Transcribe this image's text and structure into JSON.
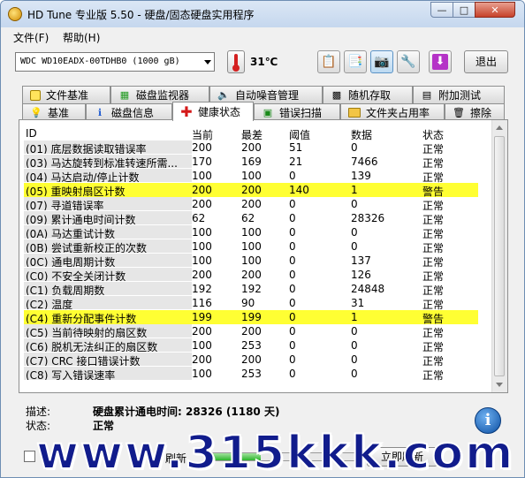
{
  "window": {
    "title": "HD Tune 专业版 5.50 - 硬盘/固态硬盘实用程序"
  },
  "menu": {
    "file": "文件(F)",
    "help": "帮助(H)"
  },
  "toolbar": {
    "drive": "WDC WD10EADX-00TDHB0 (1000 gB)",
    "temperature": "31℃",
    "exit_label": "退出"
  },
  "tabs_row1": [
    "文件基准",
    "磁盘监视器",
    "自动噪音管理",
    "随机存取",
    "附加测试"
  ],
  "tabs_row2": [
    "基准",
    "磁盘信息",
    "健康状态",
    "错误扫描",
    "文件夹占用率",
    "擦除"
  ],
  "active_tab": "健康状态",
  "columns": [
    "ID",
    "当前",
    "最差",
    "阈值",
    "数据",
    "状态"
  ],
  "rows": [
    {
      "id": "(01) 底层数据读取错误率",
      "current": "200",
      "worst": "200",
      "threshold": "51",
      "data": "0",
      "status": "正常",
      "warning": false
    },
    {
      "id": "(03) 马达旋转到标准转速所需...",
      "current": "170",
      "worst": "169",
      "threshold": "21",
      "data": "7466",
      "status": "正常",
      "warning": false
    },
    {
      "id": "(04) 马达启动/停止计数",
      "current": "100",
      "worst": "100",
      "threshold": "0",
      "data": "139",
      "status": "正常",
      "warning": false
    },
    {
      "id": "(05) 重映射扇区计数",
      "current": "200",
      "worst": "200",
      "threshold": "140",
      "data": "1",
      "status": "警告",
      "warning": true
    },
    {
      "id": "(07) 寻道错误率",
      "current": "200",
      "worst": "200",
      "threshold": "0",
      "data": "0",
      "status": "正常",
      "warning": false
    },
    {
      "id": "(09) 累计通电时间计数",
      "current": "62",
      "worst": "62",
      "threshold": "0",
      "data": "28326",
      "status": "正常",
      "warning": false
    },
    {
      "id": "(0A) 马达重试计数",
      "current": "100",
      "worst": "100",
      "threshold": "0",
      "data": "0",
      "status": "正常",
      "warning": false
    },
    {
      "id": "(0B) 尝试重新校正的次数",
      "current": "100",
      "worst": "100",
      "threshold": "0",
      "data": "0",
      "status": "正常",
      "warning": false
    },
    {
      "id": "(0C) 通电周期计数",
      "current": "100",
      "worst": "100",
      "threshold": "0",
      "data": "137",
      "status": "正常",
      "warning": false
    },
    {
      "id": "(C0) 不安全关闭计数",
      "current": "200",
      "worst": "200",
      "threshold": "0",
      "data": "126",
      "status": "正常",
      "warning": false
    },
    {
      "id": "(C1) 负载周期数",
      "current": "192",
      "worst": "192",
      "threshold": "0",
      "data": "24848",
      "status": "正常",
      "warning": false
    },
    {
      "id": "(C2) 温度",
      "current": "116",
      "worst": "90",
      "threshold": "0",
      "data": "31",
      "status": "正常",
      "warning": false
    },
    {
      "id": "(C4) 重新分配事件计数",
      "current": "199",
      "worst": "199",
      "threshold": "0",
      "data": "1",
      "status": "警告",
      "warning": true
    },
    {
      "id": "(C5) 当前待映射的扇区数",
      "current": "200",
      "worst": "200",
      "threshold": "0",
      "data": "0",
      "status": "正常",
      "warning": false
    },
    {
      "id": "(C6) 脱机无法纠正的扇区数",
      "current": "100",
      "worst": "253",
      "threshold": "0",
      "data": "0",
      "status": "正常",
      "warning": false
    },
    {
      "id": "(C7) CRC 接口错误计数",
      "current": "200",
      "worst": "200",
      "threshold": "0",
      "data": "0",
      "status": "正常",
      "warning": false
    },
    {
      "id": "(C8) 写入错误速率",
      "current": "100",
      "worst": "253",
      "threshold": "0",
      "data": "0",
      "status": "正常",
      "warning": false
    }
  ],
  "info": {
    "desc_label": "描述:",
    "desc_value": "硬盘累计通电时间: 28326 (1180 天)",
    "status_label": "状态:",
    "status_value": "正常"
  },
  "bottom": {
    "refresh_label": "刷新",
    "refresh_button": "立即刷新",
    "progress": 0.35
  },
  "watermark": "www.315kkk.com",
  "colors": {
    "warning_row": "#ffff33",
    "window_frame": "#6e8eb3"
  }
}
